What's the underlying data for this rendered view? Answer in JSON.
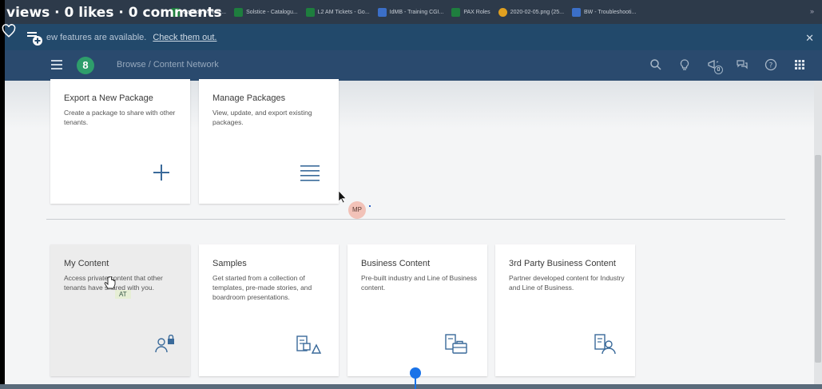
{
  "video": {
    "stats": "views · 0 likes · 0 comments",
    "progress_fraction": 0.505
  },
  "bookmarks": [
    {
      "label": "Catalog of Role...",
      "color": "#1e7e3e"
    },
    {
      "label": "Solstice - Catalogu...",
      "color": "#1e7e3e"
    },
    {
      "label": "L2 AM Tickets - Go...",
      "color": "#1e7e3e"
    },
    {
      "label": "IdMB - Training CGI...",
      "color": "#3b6fc8"
    },
    {
      "label": "PAX Roles",
      "color": "#1e7e3e"
    },
    {
      "label": "2020-02-05.png (25...",
      "color": "#e0a020"
    },
    {
      "label": "BW - Troubleshooti...",
      "color": "#3b6fc8"
    }
  ],
  "notification": {
    "text": "ew features are available.",
    "link": "Check them out.",
    "close": "✕"
  },
  "shell": {
    "logo": "8",
    "breadcrumb": "Browse  /  Content Network",
    "notification_count": "0"
  },
  "tiles_top": [
    {
      "title": "Export a New Package",
      "desc": "Create a package to share with other tenants.",
      "icon": "plus-icon"
    },
    {
      "title": "Manage Packages",
      "desc": "View, update, and export existing packages.",
      "icon": "list-icon"
    }
  ],
  "tiles_bottom": [
    {
      "title": "My Content",
      "desc": "Access private content that other tenants have shared with you.",
      "icon": "user-lock-icon"
    },
    {
      "title": "Samples",
      "desc": "Get started from a collection of templates, pre-made stories, and boardroom presentations.",
      "icon": "samples-icon"
    },
    {
      "title": "Business Content",
      "desc": "Pre-built industry and Line of Business content.",
      "icon": "business-content-icon"
    },
    {
      "title": "3rd Party Business Content",
      "desc": "Partner developed content for Industry and Line of Business.",
      "icon": "partner-content-icon"
    }
  ],
  "avatars": {
    "mp": "MP",
    "at": "AT"
  },
  "colors": {
    "shell": "#2a4a6e",
    "notify": "#22496b",
    "accent_icon": "#3a6a9a",
    "progress": "#1a73e8"
  }
}
